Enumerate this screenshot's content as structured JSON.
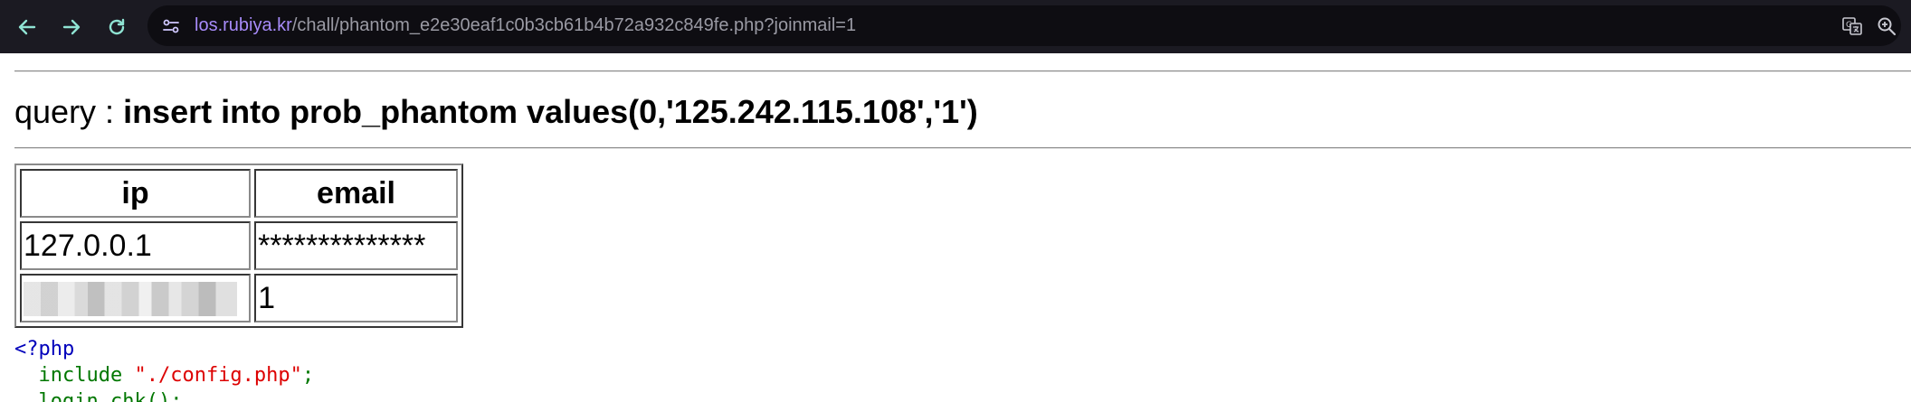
{
  "browser": {
    "url_host": "los.rubiya.kr",
    "url_path": "/chall/phantom_e2e30eaf1c0b3cb61b4b72a932c849fe.php?joinmail=1",
    "icons": [
      "back-arrow-icon",
      "forward-arrow-icon",
      "reload-icon",
      "site-info-icon",
      "translate-icon",
      "zoom-icon"
    ],
    "accent_color": "#a78bfa"
  },
  "page": {
    "query_label": "query : ",
    "query_sql": "insert into prob_phantom values(0,'125.242.115.108','1')",
    "table": {
      "headers": [
        "ip",
        "email"
      ],
      "rows": [
        [
          "127.0.0.1",
          "**************"
        ],
        [
          "",
          "1"
        ]
      ]
    },
    "code": {
      "open_tag": "<?php",
      "include_kw": "include",
      "include_str": "\"./config.php\"",
      "include_end": ";",
      "call": "login_chk();"
    }
  }
}
